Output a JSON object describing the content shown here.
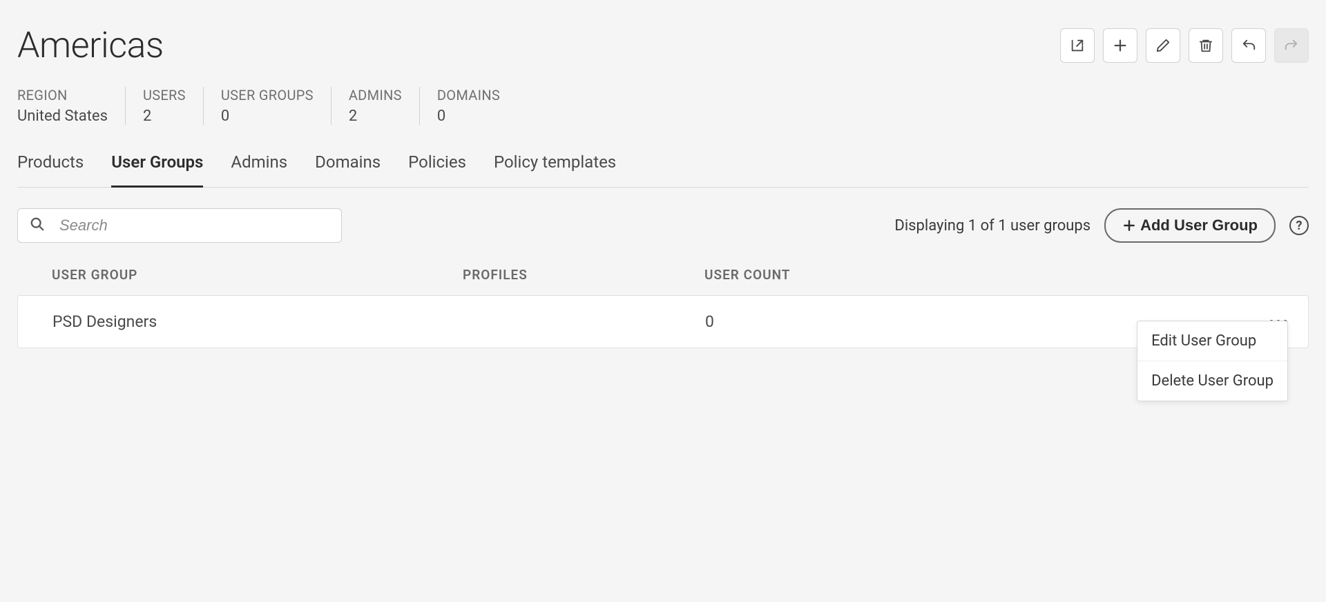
{
  "page_title": "Americas",
  "stats": [
    {
      "label": "REGION",
      "value": "United States"
    },
    {
      "label": "USERS",
      "value": "2"
    },
    {
      "label": "USER GROUPS",
      "value": "0"
    },
    {
      "label": "ADMINS",
      "value": "2"
    },
    {
      "label": "DOMAINS",
      "value": "0"
    }
  ],
  "tabs": [
    {
      "label": "Products",
      "active": false
    },
    {
      "label": "User Groups",
      "active": true
    },
    {
      "label": "Admins",
      "active": false
    },
    {
      "label": "Domains",
      "active": false
    },
    {
      "label": "Policies",
      "active": false
    },
    {
      "label": "Policy templates",
      "active": false
    }
  ],
  "search": {
    "placeholder": "Search"
  },
  "display_text": "Displaying 1 of 1 user groups",
  "add_button_label": "Add User Group",
  "table": {
    "headers": {
      "group": "USER GROUP",
      "profiles": "PROFILES",
      "count": "USER COUNT"
    },
    "rows": [
      {
        "name": "PSD Designers",
        "profiles": "",
        "user_count": "0"
      }
    ]
  },
  "dropdown": {
    "edit": "Edit User Group",
    "delete": "Delete User Group"
  },
  "help_glyph": "?"
}
